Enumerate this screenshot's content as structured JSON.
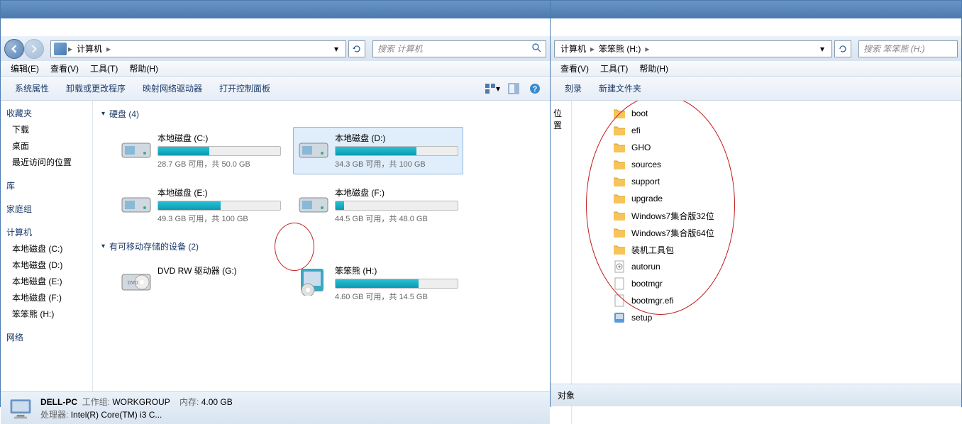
{
  "left": {
    "address": [
      "计算机"
    ],
    "search_placeholder": "搜索 计算机",
    "menus": [
      "编辑(E)",
      "查看(V)",
      "工具(T)",
      "帮助(H)"
    ],
    "toolbar": [
      "系统属性",
      "卸载或更改程序",
      "映射网络驱动器",
      "打开控制面板"
    ],
    "sidebar": {
      "favorites": "收藏夹",
      "fav_items": [
        "下载",
        "桌面",
        "最近访问的位置"
      ],
      "libs": "库",
      "home": "家庭组",
      "comp": "计算机",
      "comp_items": [
        "本地磁盘 (C:)",
        "本地磁盘 (D:)",
        "本地磁盘 (E:)",
        "本地磁盘 (F:)",
        "笨笨熊 (H:)"
      ],
      "net": "网络"
    },
    "group_hdd": "硬盘 (4)",
    "drives": [
      {
        "name": "本地磁盘 (C:)",
        "free": "28.7 GB 可用，共 50.0 GB",
        "pct": 42,
        "sel": false
      },
      {
        "name": "本地磁盘 (D:)",
        "free": "34.3 GB 可用，共 100 GB",
        "pct": 66,
        "sel": true
      },
      {
        "name": "本地磁盘 (E:)",
        "free": "49.3 GB 可用，共 100 GB",
        "pct": 51,
        "sel": false
      },
      {
        "name": "本地磁盘 (F:)",
        "free": "44.5 GB 可用，共 48.0 GB",
        "pct": 7,
        "sel": false
      }
    ],
    "group_rem": "有可移动存储的设备 (2)",
    "removable": [
      {
        "name": "DVD RW 驱动器 (G:)",
        "type": "dvd",
        "free": "",
        "pct": 0
      },
      {
        "name": "笨笨熊 (H:)",
        "type": "ext",
        "free": "4.60 GB 可用，共 14.5 GB",
        "pct": 68
      }
    ],
    "status": {
      "name": "DELL-PC",
      "wg_label": "工作组:",
      "wg": "WORKGROUP",
      "mem_label": "内存:",
      "mem": "4.00 GB",
      "cpu_label": "处理器:",
      "cpu": "Intel(R) Core(TM) i3 C..."
    }
  },
  "right": {
    "address": [
      "计算机",
      "笨笨熊 (H:)"
    ],
    "search_placeholder": "搜索 笨笨熊 (H:)",
    "menus": [
      "查看(V)",
      "工具(T)",
      "帮助(H)"
    ],
    "toolbar": [
      "刻录",
      "新建文件夹"
    ],
    "sidebar_item": "位置",
    "files": [
      {
        "n": "boot",
        "t": "folder"
      },
      {
        "n": "efi",
        "t": "folder"
      },
      {
        "n": "GHO",
        "t": "folder"
      },
      {
        "n": "sources",
        "t": "folder"
      },
      {
        "n": "support",
        "t": "folder"
      },
      {
        "n": "upgrade",
        "t": "folder"
      },
      {
        "n": "Windows7集合版32位",
        "t": "folder"
      },
      {
        "n": "Windows7集合版64位",
        "t": "folder"
      },
      {
        "n": "装机工具包",
        "t": "folder"
      },
      {
        "n": "autorun",
        "t": "inf"
      },
      {
        "n": "bootmgr",
        "t": "file"
      },
      {
        "n": "bootmgr.efi",
        "t": "file"
      },
      {
        "n": "setup",
        "t": "exe"
      }
    ],
    "status_obj": "对象"
  }
}
